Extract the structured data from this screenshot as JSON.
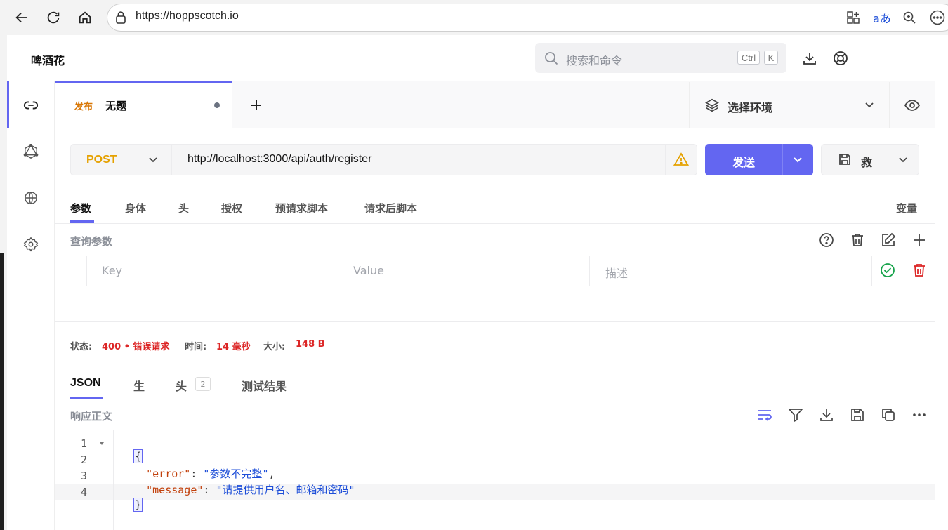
{
  "browser": {
    "url": "https://hoppscotch.io",
    "icons": [
      "back-arrow-icon",
      "refresh-icon",
      "home-icon",
      "lock-icon",
      "split-tab-icon",
      "translate-icon",
      "zoom-icon",
      "more-icon"
    ]
  },
  "app": {
    "title": "啤酒花",
    "search_placeholder": "搜索和命令",
    "kbd_ctrl": "Ctrl",
    "kbd_k": "K"
  },
  "tab": {
    "method_tag": "发布",
    "name": "无题"
  },
  "environment": {
    "label": "选择环境"
  },
  "request": {
    "method": "POST",
    "url": "http://localhost:3000/api/auth/register",
    "send_label": "发送",
    "save_label": "救"
  },
  "request_tabs": [
    "参数",
    "身体",
    "头",
    "授权",
    "预请求脚本",
    "请求后脚本"
  ],
  "variables_label": "变量",
  "query": {
    "title": "查询参数",
    "key_placeholder": "Key",
    "value_placeholder": "Value",
    "desc_placeholder": "描述"
  },
  "status": {
    "status_label": "状态:",
    "status_value": "400 • 错误请求",
    "time_label": "时间:",
    "time_value": "14 毫秒",
    "size_label": "大小:",
    "size_value": "148 B"
  },
  "response_tabs": {
    "json": "JSON",
    "raw": "生",
    "headers": "头",
    "headers_count": "2",
    "tests": "测试结果"
  },
  "response_body_title": "响应正文",
  "code": {
    "line_numbers": [
      "1",
      "2",
      "3",
      "4"
    ],
    "open_brace": "{",
    "close_brace": "}",
    "key1": "\"error\"",
    "val1": "\"参数不完整\"",
    "key2": "\"message\"",
    "val2": "\"请提供用户名、邮箱和密码\""
  },
  "colors": {
    "accent": "#6366f1",
    "method": "#e5a100",
    "error": "#dc2626",
    "success": "#16a34a"
  }
}
